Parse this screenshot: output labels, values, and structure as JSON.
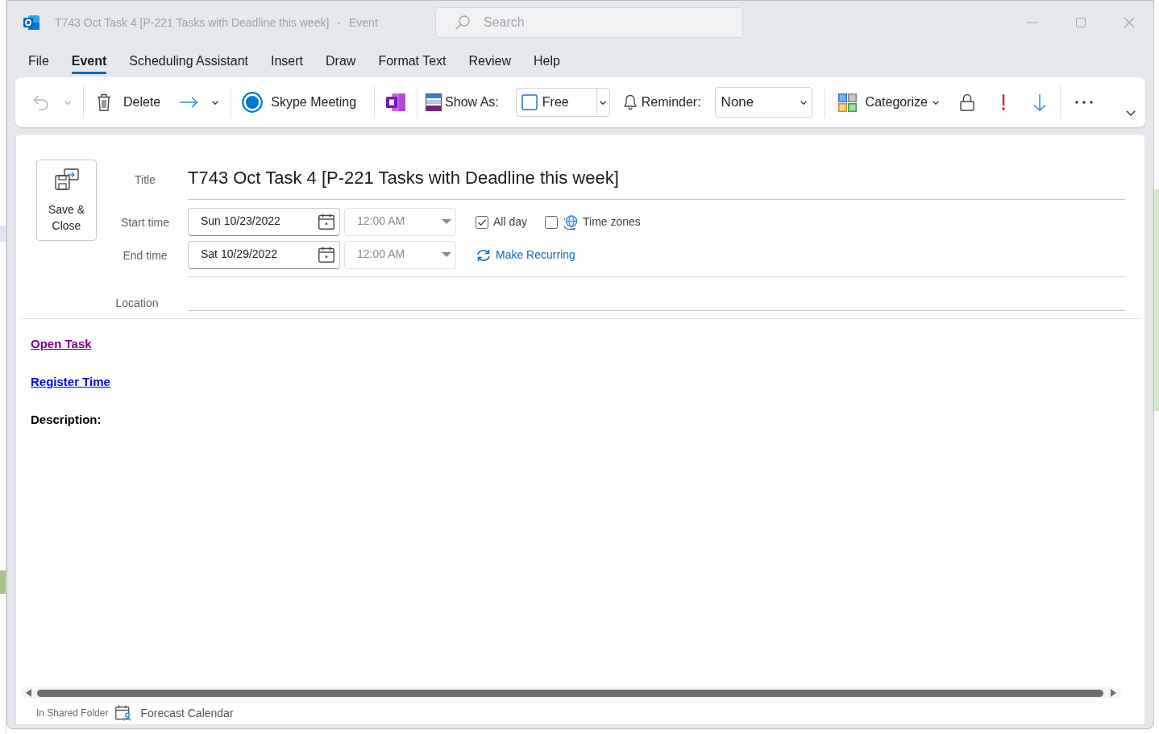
{
  "window": {
    "title": "T743 Oct Task 4 [P-221 Tasks with Deadline this week]",
    "separator": "-",
    "item_type": "Event"
  },
  "search": {
    "placeholder": "Search"
  },
  "tabs": [
    {
      "label": "File",
      "selected": false
    },
    {
      "label": "Event",
      "selected": true
    },
    {
      "label": "Scheduling Assistant",
      "selected": false
    },
    {
      "label": "Insert",
      "selected": false
    },
    {
      "label": "Draw",
      "selected": false
    },
    {
      "label": "Format Text",
      "selected": false
    },
    {
      "label": "Review",
      "selected": false
    },
    {
      "label": "Help",
      "selected": false
    }
  ],
  "ribbon": {
    "groups": [
      [
        {
          "kind": "undo",
          "disabled": true
        }
      ],
      [
        {
          "kind": "delete",
          "label": "Delete",
          "disabled": false
        },
        {
          "kind": "forward",
          "disabled": false
        }
      ],
      [
        {
          "kind": "skype",
          "label": "Skype Meeting",
          "disabled": false
        }
      ],
      [
        {
          "kind": "onenote",
          "disabled": false
        }
      ],
      [
        {
          "kind": "show_as",
          "label": "Show As:",
          "disabled": false
        },
        {
          "kind": "status_dropdown",
          "value": "Free",
          "disabled": false
        },
        {
          "kind": "reminder",
          "label": "Reminder:",
          "disabled": false
        },
        {
          "kind": "dropdown",
          "value": "None",
          "disabled": false
        }
      ],
      [
        {
          "kind": "categorize",
          "label": "Categorize",
          "disabled": false
        },
        {
          "kind": "private",
          "disabled": false
        },
        {
          "kind": "high_importance",
          "disabled": false
        },
        {
          "kind": "low_importance",
          "disabled": false
        }
      ],
      [
        {
          "kind": "more",
          "disabled": false
        }
      ]
    ]
  },
  "save_close": {
    "label": "Save & Close"
  },
  "form": {
    "title": {
      "label": "Title",
      "value": "T743 Oct Task 4 [P-221 Tasks with Deadline this week]"
    },
    "start": {
      "label": "Start time",
      "date": "Sun 10/23/2022",
      "time": "12:00 AM",
      "time_disabled": true
    },
    "end": {
      "label": "End time",
      "date": "Sat 10/29/2022",
      "time": "12:00 AM",
      "time_disabled": true
    },
    "all_day": {
      "label": "All day",
      "checked": true
    },
    "time_zones": {
      "label": "Time zones",
      "checked": false
    },
    "recurring": {
      "label": "Make Recurring"
    },
    "location": {
      "label": "Location"
    }
  },
  "body": [
    {
      "kind": "link",
      "text": "Open Task",
      "visited": true
    },
    {
      "kind": "link",
      "text": "Register Time",
      "visited": false
    },
    {
      "kind": "heading",
      "text": "Description:"
    }
  ],
  "status_bar": {
    "context": "In Shared Folder",
    "folder": "Forecast Calendar"
  }
}
